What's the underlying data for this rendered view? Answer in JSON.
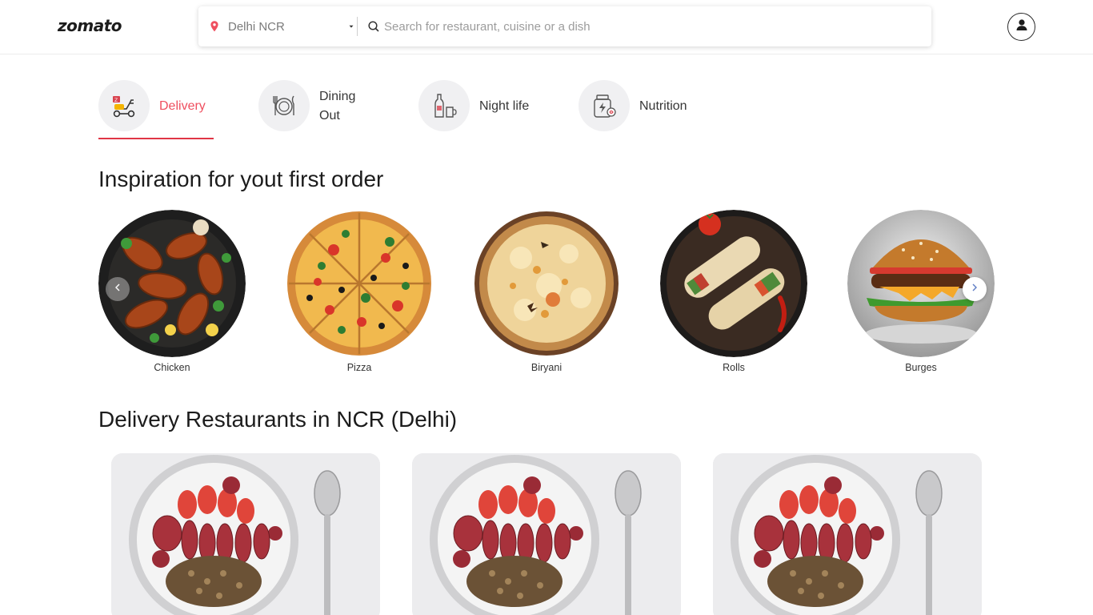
{
  "header": {
    "logo": "zomato",
    "location": "Delhi NCR",
    "search_placeholder": "Search for restaurant, cuisine or a dish"
  },
  "tabs": [
    {
      "label": "Delivery",
      "icon": "scooter-icon",
      "active": true
    },
    {
      "label": "Dining Out",
      "icon": "dining-plate-icon",
      "active": false
    },
    {
      "label": "Night life",
      "icon": "bottle-glass-icon",
      "active": false
    },
    {
      "label": "Nutrition",
      "icon": "supplement-jar-icon",
      "active": false
    }
  ],
  "inspiration": {
    "title": "Inspiration for yout first order",
    "items": [
      {
        "label": "Chicken"
      },
      {
        "label": "Pizza"
      },
      {
        "label": "Biryani"
      },
      {
        "label": "Rolls"
      },
      {
        "label": "Burges"
      }
    ]
  },
  "restaurants": {
    "title": "Delivery Restaurants in NCR (Delhi)",
    "cards": [
      {
        "image": "fruit-yogurt-bowl"
      },
      {
        "image": "fruit-yogurt-bowl"
      },
      {
        "image": "fruit-yogurt-bowl"
      }
    ]
  },
  "colors": {
    "accent": "#ef4f5f",
    "underline": "#e03546",
    "text": "#1c1c1c"
  }
}
